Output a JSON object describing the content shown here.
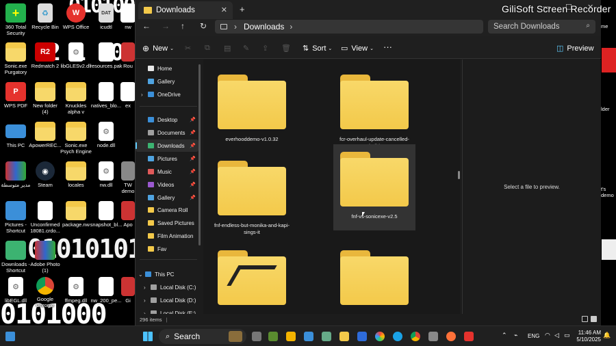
{
  "desktop": {
    "glitch_text": [
      "0101000",
      "01010101",
      "R2 1 1000"
    ],
    "icons": [
      {
        "label": "360 Total Security"
      },
      {
        "label": "Recycle Bin"
      },
      {
        "label": "WPS Office"
      },
      {
        "label": "icudtl"
      },
      {
        "label": "nw"
      },
      {
        "label": "Sonic.exe Purgatory"
      },
      {
        "label": "Redmatch 2"
      },
      {
        "label": "libGLESv2.dll"
      },
      {
        "label": "resources.pak"
      },
      {
        "label": "Rou"
      },
      {
        "label": "WPS PDF"
      },
      {
        "label": "New folder (4)"
      },
      {
        "label": "Knuckles alpha v"
      },
      {
        "label": "natives_blo..."
      },
      {
        "label": "ex"
      },
      {
        "label": "This PC"
      },
      {
        "label": "ApowerREC..."
      },
      {
        "label": "Sonic.exe Psych Engine"
      },
      {
        "label": "node.dll"
      },
      {
        "label": "مدير متوسطة"
      },
      {
        "label": "Steam"
      },
      {
        "label": "locales"
      },
      {
        "label": "nw.dll"
      },
      {
        "label": "TW demo"
      },
      {
        "label": "Pictures - Shortcut"
      },
      {
        "label": "Unconfirmed 18081.crdo..."
      },
      {
        "label": "package.nw"
      },
      {
        "label": "snapshot_bl..."
      },
      {
        "label": "Apo"
      },
      {
        "label": "Downloads - Shortcut"
      },
      {
        "label": "Adobe Photo (1)"
      },
      {
        "label": "libEGL.dll"
      },
      {
        "label": "Google Chrome"
      },
      {
        "label": "ffmpeg.dll"
      },
      {
        "label": "nw_200_pe..."
      },
      {
        "label": "Gi"
      }
    ],
    "right_edge": [
      "me",
      "lder",
      "t's demo"
    ]
  },
  "watermark": "GiliSoft Screen Recorder",
  "explorer": {
    "tab_title": "Downloads",
    "new_tab": "+",
    "address_path": "Downloads",
    "search_placeholder": "Search Downloads",
    "commands": {
      "new": "New",
      "sort": "Sort",
      "view": "View",
      "more": "···",
      "preview": "Preview"
    },
    "nav": {
      "items": [
        {
          "label": "Home",
          "color": "#e8e8e8"
        },
        {
          "label": "Gallery",
          "color": "#4fa3e0"
        },
        {
          "label": "OneDrive",
          "color": "#3b8fd9"
        },
        {
          "label": "Desktop",
          "color": "#3b8fd9",
          "pinned": true
        },
        {
          "label": "Documents",
          "color": "#a0a0a0",
          "pinned": true
        },
        {
          "label": "Downloads",
          "color": "#3cb371",
          "pinned": true,
          "selected": true
        },
        {
          "label": "Pictures",
          "color": "#4fa3e0",
          "pinned": true
        },
        {
          "label": "Music",
          "color": "#e05a5a",
          "pinned": true
        },
        {
          "label": "Videos",
          "color": "#9b59d0",
          "pinned": true
        },
        {
          "label": "Gallery",
          "color": "#4fa3e0",
          "pinned": true
        },
        {
          "label": "Camera Roll",
          "color": "#f3c94a"
        },
        {
          "label": "Saved Pictures",
          "color": "#f3c94a"
        },
        {
          "label": "Film Animation",
          "color": "#f3c94a"
        },
        {
          "label": "Fav",
          "color": "#f3c94a"
        },
        {
          "label": "This PC",
          "color": "#3b8fd9"
        },
        {
          "label": "Local Disk (C:)",
          "color": "#a0a0a0"
        },
        {
          "label": "Local Disk (D:)",
          "color": "#a0a0a0"
        },
        {
          "label": "Local Disk (E:)",
          "color": "#a0a0a0"
        }
      ]
    },
    "files": [
      {
        "name": "everhooddemo-v1.0.32",
        "thumb": "plain"
      },
      {
        "name": "fcr-overhaul-update-cancelled-build",
        "thumb": "paper"
      },
      {
        "name": "fnf-endless-but-monika-and-kapi-sings-it",
        "thumb": "plain"
      },
      {
        "name": "fnf-vs-sonicexe-v2.5",
        "thumb": "plain",
        "selected": true
      },
      {
        "name": "",
        "thumb": "logo"
      },
      {
        "name": "",
        "thumb": "plain"
      }
    ],
    "preview_text": "Select a file to preview.",
    "status": "296 items"
  },
  "taskbar": {
    "search": "Search",
    "lang": "ENG",
    "time": "11:46 AM",
    "date": "5/10/2025"
  }
}
